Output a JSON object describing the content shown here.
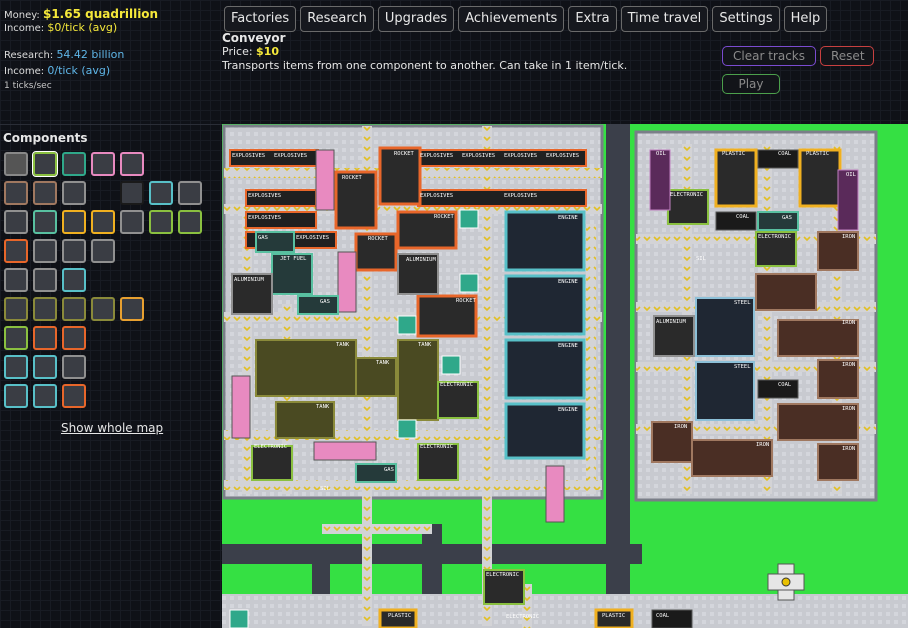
{
  "stats": {
    "money_label": "Money:",
    "money": "$1.65 quadrillion",
    "income_label": "Income:",
    "income": "$0/tick (avg)",
    "research_label": "Research:",
    "research": "54.42 billion",
    "rincome_label": "Income:",
    "rincome": "0/tick (avg)",
    "ticks": "1 ticks/sec"
  },
  "nav": [
    "Factories",
    "Research",
    "Upgrades",
    "Achievements",
    "Extra",
    "Time travel",
    "Settings",
    "Help"
  ],
  "info": {
    "title": "Conveyor",
    "price_label": "Price: ",
    "price": "$10",
    "description": "Transports items from one component to another. Can take in 1 item/tick."
  },
  "controls": {
    "clear": "Clear tracks",
    "reset": "Reset",
    "play": "Play"
  },
  "components": {
    "title": "Components",
    "show_map": "Show whole map"
  },
  "colors": {
    "money": "#f5e83a",
    "research": "#5fb6e8",
    "grass": "#33e142",
    "conveyor": "#d0d0d0"
  },
  "map_labels": {
    "explosives": "EXPLOSIVES",
    "rocket": "ROCKET",
    "engine": "ENGINE",
    "oil": "OIL",
    "plastic": "PLASTIC",
    "coal": "COAL",
    "iron": "IRON",
    "steel": "STEEL",
    "aluminium": "ALUMINIUM",
    "gas": "GAS",
    "jet_fuel": "JET FUEL",
    "tank": "TANK",
    "electronic": "ELECTRONIC",
    "sil": "SIL"
  }
}
